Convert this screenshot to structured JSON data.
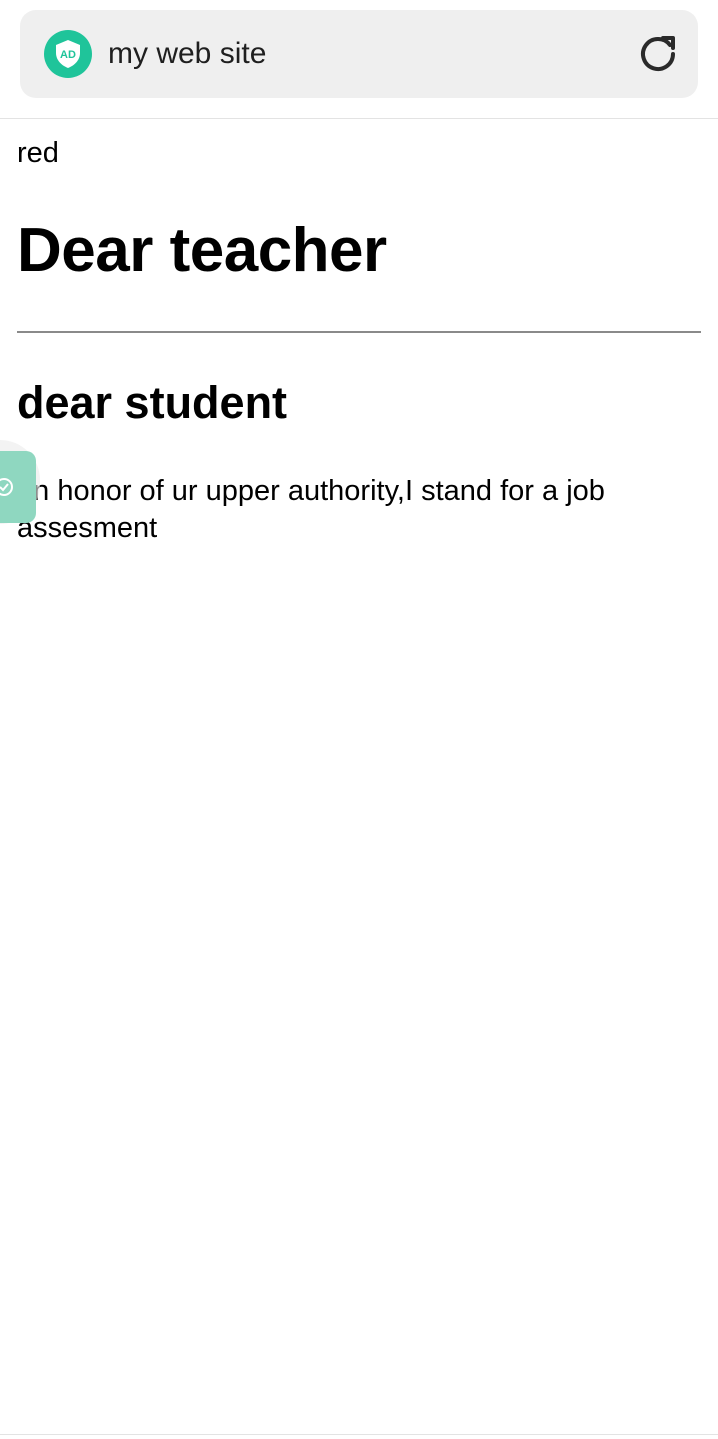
{
  "browser": {
    "title": "my web site",
    "badge_icon": "adguard-shield-icon",
    "reload_icon": "reload-icon",
    "accent_color": "#1fc49a"
  },
  "page": {
    "small_text": "red",
    "heading": "Dear teacher",
    "subheading": "dear student",
    "paragraph": "on honor of ur upper authority,I stand for a job assesment"
  },
  "floating_widget": {
    "icon": "shield-check-icon",
    "color": "#8fd7c0"
  }
}
